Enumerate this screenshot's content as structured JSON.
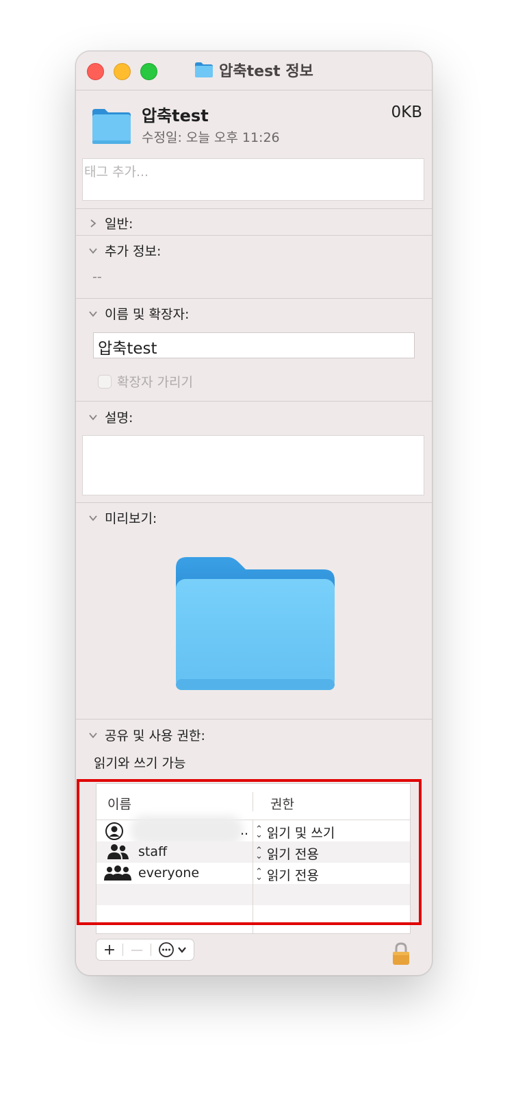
{
  "window": {
    "title": "압축test 정보"
  },
  "header": {
    "name": "압축test",
    "size": "0KB",
    "modified": "수정일: 오늘 오후 11:26"
  },
  "tags": {
    "placeholder": "태그 추가..."
  },
  "sections": {
    "general": "일반:",
    "more_info": "추가 정보:",
    "more_info_value": "--",
    "name_ext": "이름 및 확장자:",
    "name_value": "압축test",
    "hide_ext": "확장자 가리기",
    "comments": "설명:",
    "preview": "미리보기:",
    "sharing": "공유 및 사용 권한:",
    "access_summary": "읽기와 쓰기 가능"
  },
  "permissions": {
    "col_name": "이름",
    "col_privilege": "권한",
    "rows": [
      {
        "name": "",
        "privilege": "읽기 및 쓰기",
        "icon": "user-icon"
      },
      {
        "name": "staff",
        "privilege": "읽기 전용",
        "icon": "group-icon"
      },
      {
        "name": "everyone",
        "privilege": "읽기 전용",
        "icon": "everyone-icon"
      }
    ],
    "truncation": ".."
  },
  "toolbar": {
    "add": "+",
    "remove": "—"
  },
  "colors": {
    "folder_blue": "#6fc7f5",
    "highlight_red": "#e00000"
  }
}
